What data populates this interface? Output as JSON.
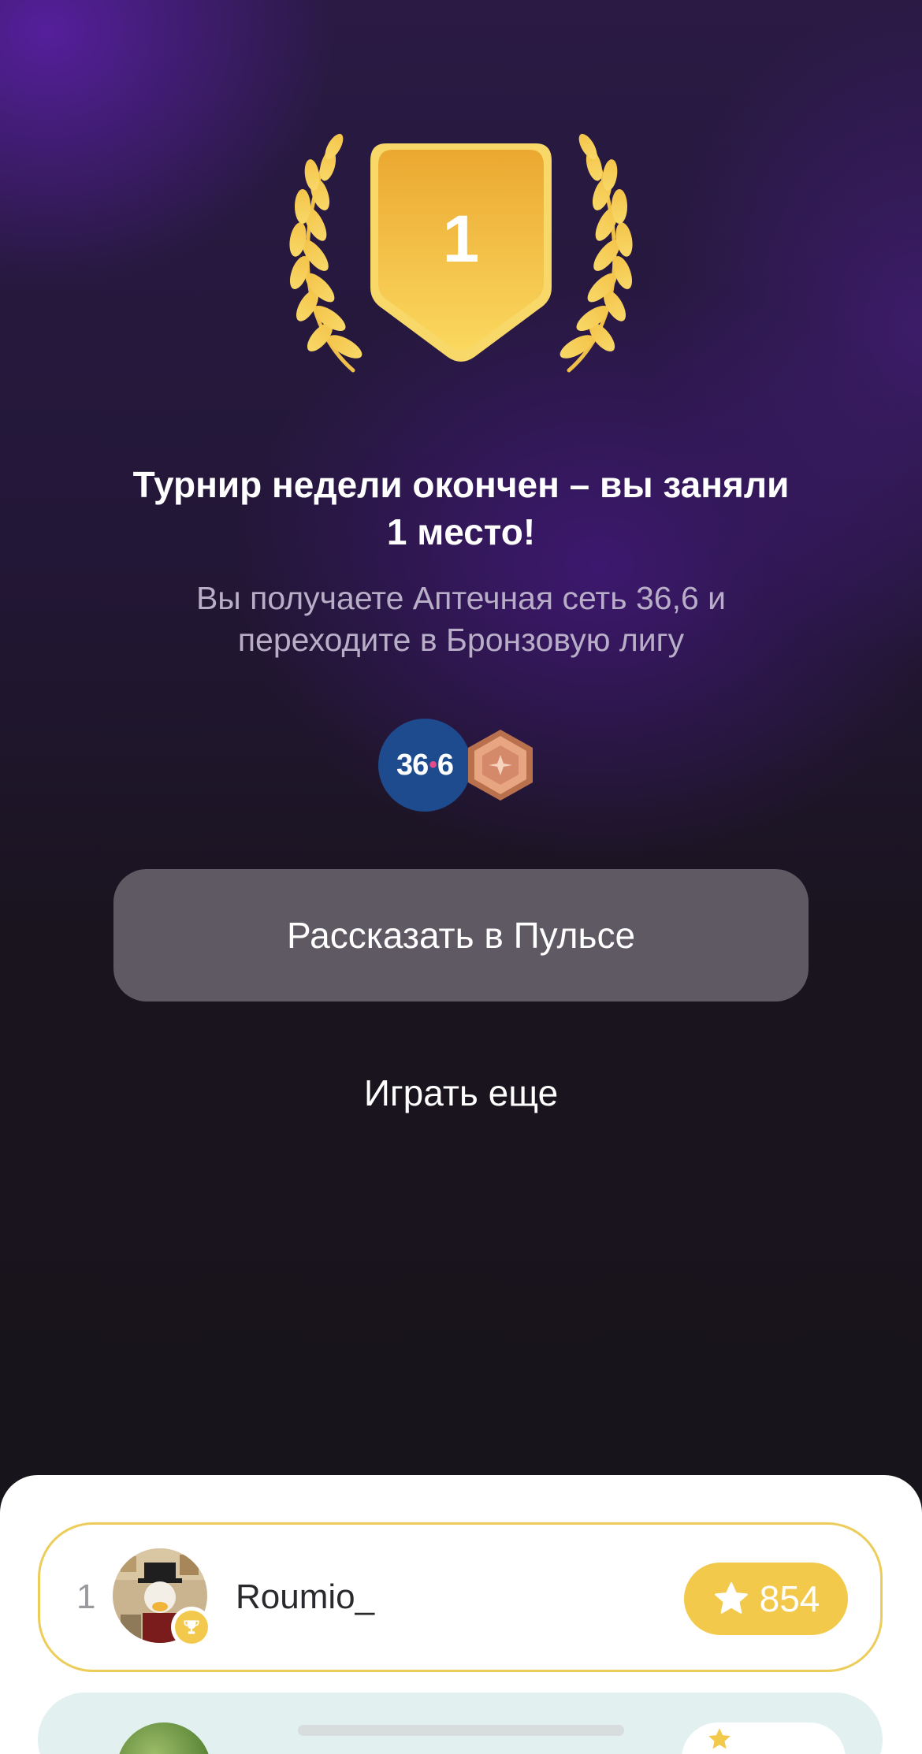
{
  "award": {
    "place": "1"
  },
  "result": {
    "title": "Турнир недели окончен – вы заняли 1 место!",
    "subtitle": "Вы получаете Аптечная сеть 36,6 и переходите в Бронзовую лигу"
  },
  "rewards": {
    "pharmacy_logo_left": "36",
    "pharmacy_logo_right": "6",
    "pharmacy_icon": "pharmacy-36-6-logo",
    "league_icon": "bronze-league-hexagon-icon"
  },
  "actions": {
    "share_label": "Рассказать в Пульсе",
    "play_again_label": "Играть еще"
  },
  "leaderboard": {
    "rows": [
      {
        "rank": "1",
        "username": "Roumio_",
        "score": "854",
        "badge_icon": "trophy-icon",
        "score_icon": "star-icon"
      }
    ]
  },
  "colors": {
    "gold": "#f3c94c",
    "share_button_bg": "#5f5963",
    "background_dark": "#18141b",
    "purple_glow": "#5c20aa",
    "next_row_bg": "#e2f0f0"
  }
}
